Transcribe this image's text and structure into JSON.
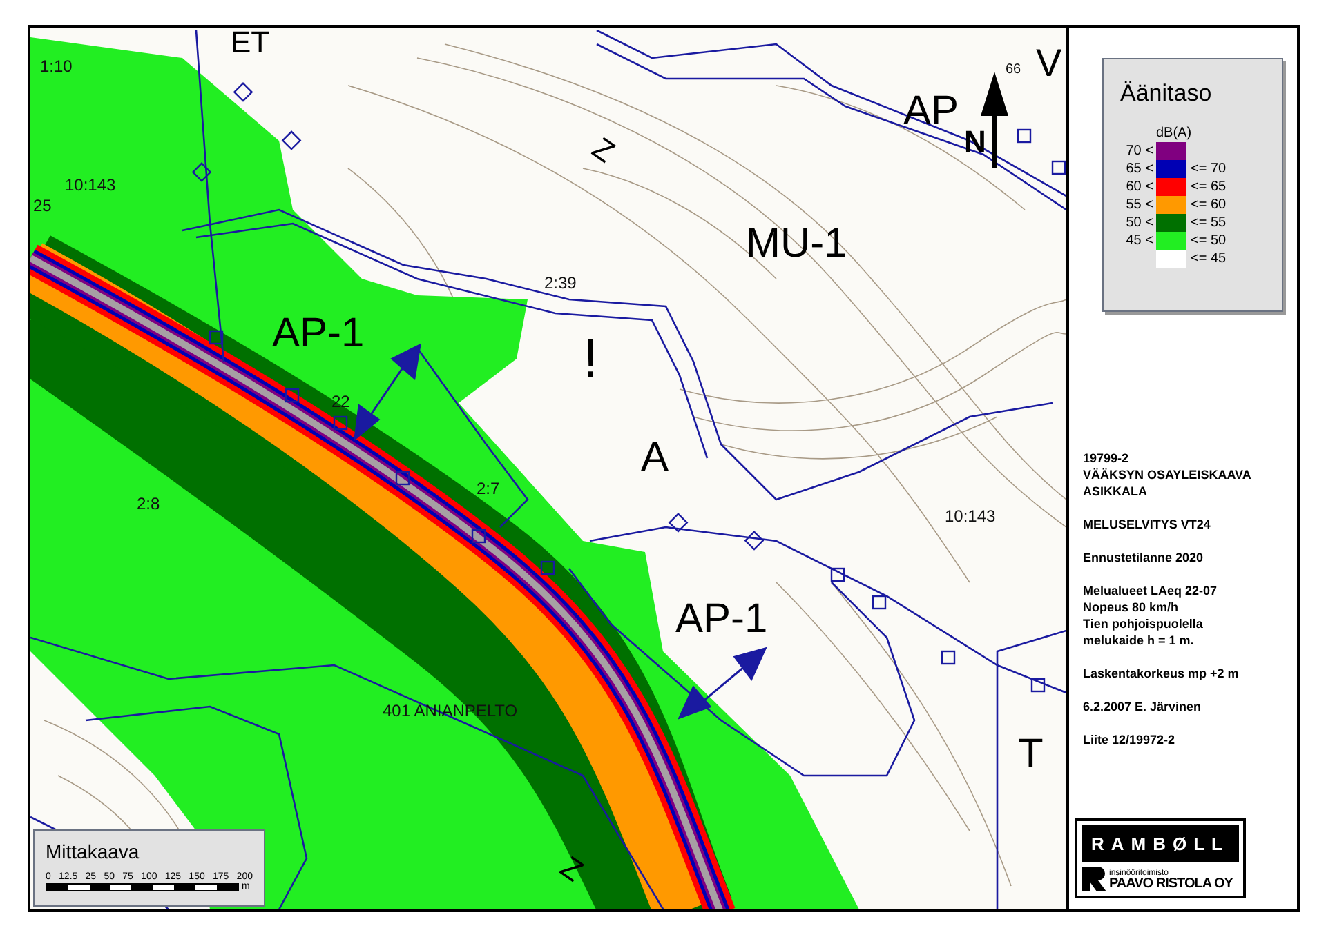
{
  "map": {
    "labels": [
      {
        "text": "ET",
        "kind": "zone"
      },
      {
        "text": "1:10",
        "kind": "number"
      },
      {
        "text": "10:143",
        "kind": "number"
      },
      {
        "text": "25",
        "kind": "number"
      },
      {
        "text": "Z",
        "kind": "tilted"
      },
      {
        "text": "AP",
        "kind": "zone"
      },
      {
        "text": "N",
        "kind": "north"
      },
      {
        "text": "66",
        "kind": "number"
      },
      {
        "text": "V",
        "kind": "zone"
      },
      {
        "text": "MU-1",
        "kind": "zone"
      },
      {
        "text": "2:39",
        "kind": "number"
      },
      {
        "text": "AP-1",
        "kind": "zone"
      },
      {
        "text": "!",
        "kind": "mark"
      },
      {
        "text": "22",
        "kind": "number"
      },
      {
        "text": "2:7",
        "kind": "number"
      },
      {
        "text": "2:8",
        "kind": "number"
      },
      {
        "text": "A",
        "kind": "zone"
      },
      {
        "text": "10:143",
        "kind": "number"
      },
      {
        "text": "AP-1",
        "kind": "zone"
      },
      {
        "text": "401 ANIANPELTO",
        "kind": "number"
      },
      {
        "text": "T",
        "kind": "zone"
      },
      {
        "text": "Z",
        "kind": "tilted"
      }
    ]
  },
  "scale": {
    "title": "Mittakaava",
    "ticks": [
      "0",
      "12.5",
      "25",
      "50",
      "75",
      "100",
      "125",
      "150",
      "175",
      "200"
    ],
    "unit": "m"
  },
  "legend": {
    "title": "Äänitaso",
    "unit": "dB(A)",
    "rows": [
      {
        "from": "70 <",
        "color": "#800080"
      },
      {
        "from": "65 <",
        "to": "<= 70",
        "color": "#0000b4"
      },
      {
        "from": "60 <",
        "to": "<= 65",
        "color": "#ff0000"
      },
      {
        "from": "55 <",
        "to": "<= 60",
        "color": "#ff9900"
      },
      {
        "from": "50 <",
        "to": "<= 55",
        "color": "#007000"
      },
      {
        "from": "45 <",
        "to": "<= 50",
        "color": "#22ee22"
      },
      {
        "to": "<= 45",
        "color": "#ffffff"
      }
    ]
  },
  "notes": [
    [
      "19799-2",
      "VÄÄKSYN OSAYLEISKAAVA",
      "ASIKKALA"
    ],
    [
      "MELUSELVITYS VT24"
    ],
    [
      "Ennustetilanne 2020"
    ],
    [
      "Melualueet LAeq 22-07",
      "Nopeus 80 km/h",
      "Tien pohjoispuolella",
      "melukaide h = 1 m."
    ],
    [
      "Laskentakorkeus mp +2 m"
    ],
    [
      "6.2.2007 E. Järvinen"
    ],
    [
      "Liite 12/19972-2"
    ]
  ],
  "logo": {
    "brand": "RAMBØLL",
    "subtitle": "insinööritoimisto",
    "company": "PAAVO RISTOLA OY"
  }
}
